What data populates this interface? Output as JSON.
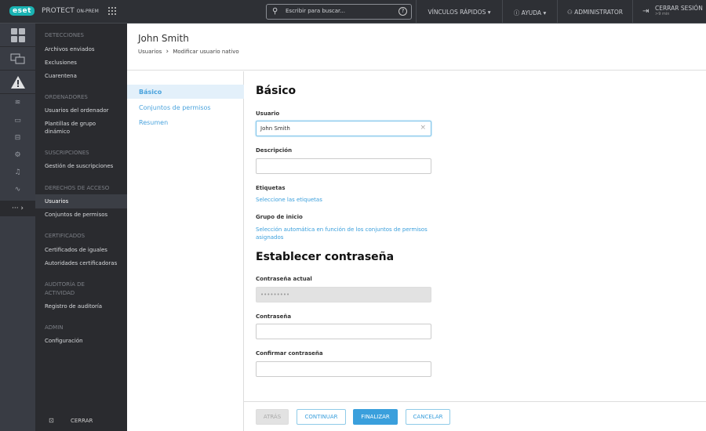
{
  "topbar": {
    "logo": "eset",
    "product": "PROTECT",
    "product_suffix": "ON-PREM",
    "search_placeholder": "Escribir para buscar...",
    "quick_links": "VÍNCULOS RÁPIDOS",
    "help": "AYUDA",
    "user": "ADMINISTRATOR",
    "logout": "CERRAR SESIÓN",
    "session_time": ">9 min"
  },
  "nav": {
    "detecciones": "DETECCIONES",
    "archivos": "Archivos enviados",
    "exclusiones": "Exclusiones",
    "cuarentena": "Cuarentena",
    "ordenadores": "ORDENADORES",
    "usuarios_ord": "Usuarios del ordenador",
    "plantillas": "Plantillas de grupo dinámico",
    "suscripciones": "SUSCRIPCIONES",
    "gestion": "Gestión de suscripciones",
    "derechos": "DERECHOS DE ACCESO",
    "usuarios": "Usuarios",
    "conjuntos": "Conjuntos de permisos",
    "certificados": "CERTIFICADOS",
    "cert_iguales": "Certificados de iguales",
    "autoridades": "Autoridades certificadoras",
    "auditoria": "AUDITORÍA DE ACTIVIDAD",
    "registro": "Registro de auditoría",
    "admin": "ADMIN",
    "configuracion": "Configuración",
    "cerrar": "CERRAR"
  },
  "header": {
    "title": "John Smith",
    "breadcrumb_root": "Usuarios",
    "breadcrumb_current": "Modificar usuario nativo"
  },
  "wizard": {
    "steps": [
      "Básico",
      "Conjuntos de permisos",
      "Resumen"
    ]
  },
  "form": {
    "basic_heading": "Básico",
    "usuario_label": "Usuario",
    "usuario_value": "John Smith",
    "descripcion_label": "Descripción",
    "descripcion_value": "",
    "etiquetas_label": "Etiquetas",
    "etiquetas_link": "Seleccione las etiquetas",
    "grupo_label": "Grupo de inicio",
    "grupo_link": "Selección automática en función de los conjuntos de permisos asignados",
    "password_heading": "Establecer contraseña",
    "actual_label": "Contraseña actual",
    "actual_value": "•••••••••",
    "password_label": "Contraseña",
    "confirm_label": "Confirmar contraseña"
  },
  "footer": {
    "back": "ATRÁS",
    "continue": "CONTINUAR",
    "finish": "FINALIZAR",
    "cancel": "CANCELAR"
  },
  "colors": {
    "accent": "#3a9fdc",
    "brand": "#1ab3b3"
  }
}
